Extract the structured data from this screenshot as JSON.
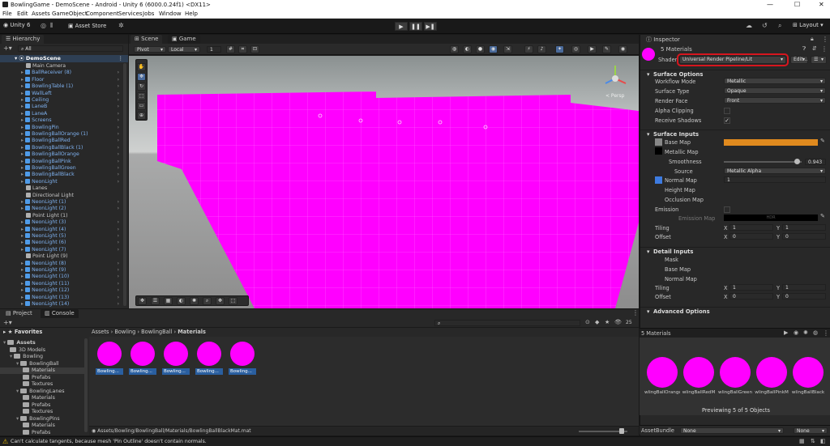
{
  "window": {
    "title": "BowlingGame - DemoScene - Android - Unity 6 (6000.0.24f1) <DX11>",
    "minimize": "—",
    "maximize": "☐",
    "close": "✕"
  },
  "menu": [
    "File",
    "Edit",
    "Assets",
    "GameObject",
    "Component",
    "Services",
    "Jobs",
    "Window",
    "Help"
  ],
  "toolbar": {
    "account": "Unity 6",
    "asset_store": "Asset Store",
    "layout": "Layout",
    "play_icons": [
      "▶",
      "❚❚",
      "▶❚"
    ]
  },
  "hierarchy": {
    "tab": "Hierarchy",
    "search_placeholder": "All",
    "scene": "DemoScene",
    "items": [
      {
        "label": "Main Camera",
        "kind": "g",
        "chev": false
      },
      {
        "label": "BallReceiver (8)",
        "kind": "b",
        "chev": true
      },
      {
        "label": "Floor",
        "kind": "b",
        "chev": true
      },
      {
        "label": "BowlingTable (1)",
        "kind": "b",
        "chev": true
      },
      {
        "label": "WallLeft",
        "kind": "b",
        "chev": true
      },
      {
        "label": "Ceiling",
        "kind": "b",
        "chev": true
      },
      {
        "label": "LaneB",
        "kind": "b",
        "chev": true
      },
      {
        "label": "LaneA",
        "kind": "b",
        "chev": true
      },
      {
        "label": "Screens",
        "kind": "b",
        "chev": true
      },
      {
        "label": "BowlingPin",
        "kind": "b",
        "chev": true
      },
      {
        "label": "BowlingBallOrange (1)",
        "kind": "b",
        "chev": true
      },
      {
        "label": "BowlingBallRed",
        "kind": "b",
        "chev": true
      },
      {
        "label": "BowlingBallBlack (1)",
        "kind": "b",
        "chev": true
      },
      {
        "label": "BowlingBallOrange",
        "kind": "b",
        "chev": true
      },
      {
        "label": "BowlingBallPink",
        "kind": "b",
        "chev": true
      },
      {
        "label": "BowlingBallGreen",
        "kind": "b",
        "chev": true
      },
      {
        "label": "BowlingBallBlack",
        "kind": "b",
        "chev": true
      },
      {
        "label": "NeonLight",
        "kind": "b",
        "chev": true
      },
      {
        "label": "Lanes",
        "kind": "g",
        "chev": false
      },
      {
        "label": "Directional Light",
        "kind": "g",
        "chev": false
      },
      {
        "label": "NeonLight (1)",
        "kind": "b",
        "chev": true
      },
      {
        "label": "NeonLight (2)",
        "kind": "b",
        "chev": true
      },
      {
        "label": "Point Light (1)",
        "kind": "g",
        "chev": false
      },
      {
        "label": "NeonLight (3)",
        "kind": "b",
        "chev": true
      },
      {
        "label": "NeonLight (4)",
        "kind": "b",
        "chev": true
      },
      {
        "label": "NeonLight (5)",
        "kind": "b",
        "chev": true
      },
      {
        "label": "NeonLight (6)",
        "kind": "b",
        "chev": true
      },
      {
        "label": "NeonLight (7)",
        "kind": "b",
        "chev": true
      },
      {
        "label": "Point Light (9)",
        "kind": "g",
        "chev": false
      },
      {
        "label": "NeonLight (8)",
        "kind": "b",
        "chev": true
      },
      {
        "label": "NeonLight (9)",
        "kind": "b",
        "chev": true
      },
      {
        "label": "NeonLight (10)",
        "kind": "b",
        "chev": true
      },
      {
        "label": "NeonLight (11)",
        "kind": "b",
        "chev": true
      },
      {
        "label": "NeonLight (12)",
        "kind": "b",
        "chev": true
      },
      {
        "label": "NeonLight (13)",
        "kind": "b",
        "chev": true
      },
      {
        "label": "NeonLight (14)",
        "kind": "b",
        "chev": true
      }
    ]
  },
  "scene": {
    "tabs": [
      "Scene",
      "Game"
    ],
    "pivot": "Pivot",
    "local": "Local",
    "grid_snap": "1",
    "persp": "< Persp",
    "magenta": "#ff00ff"
  },
  "inspector": {
    "tab": "Inspector",
    "materials_count": "5 Materials",
    "shader_label": "Shader",
    "shader_value": "Universal Render Pipeline/Lit",
    "edit_button": "Edit...",
    "surface_options": {
      "header": "Surface Options",
      "rows": [
        {
          "label": "Workflow Mode",
          "value": "Metallic"
        },
        {
          "label": "Surface Type",
          "value": "Opaque"
        },
        {
          "label": "Render Face",
          "value": "Front"
        }
      ],
      "alpha_clipping": "Alpha Clipping",
      "receive_shadows": "Receive Shadows"
    },
    "surface_inputs": {
      "header": "Surface Inputs",
      "base_map": "Base Map",
      "base_color": "#e08a1e",
      "metallic_map": "Metallic Map",
      "smoothness": "Smoothness",
      "smoothness_value": "0.943",
      "smoothness_fraction": 0.943,
      "source": "Source",
      "source_value": "Metallic Alpha",
      "normal_map": "Normal Map",
      "normal_value": "1",
      "height_map": "Height Map",
      "occlusion_map": "Occlusion Map",
      "emission": "Emission",
      "emission_map": "Emission Map",
      "hdr": "HDR",
      "tiling": "Tiling",
      "offset": "Offset",
      "tiling_x": "1",
      "tiling_y": "1",
      "offset_x": "0",
      "offset_y": "0"
    },
    "detail_inputs": {
      "header": "Detail Inputs",
      "mask": "Mask",
      "base_map": "Base Map",
      "normal_map": "Normal Map",
      "tiling": "Tiling",
      "offset": "Offset",
      "tiling_x": "1",
      "tiling_y": "1",
      "offset_x": "0",
      "offset_y": "0"
    },
    "advanced": "Advanced Options",
    "preview": {
      "title": "5 Materials",
      "labels": [
        "wlingBallOrange",
        "wlingBallRedM",
        "wlingBallGreen",
        "wlingBallPinkM",
        "wlingBallBlack"
      ],
      "status": "Previewing 5 of 5 Objects"
    },
    "asset_bundle": "AssetBundle",
    "bundle_none1": "None",
    "bundle_none2": "None"
  },
  "project": {
    "tabs": [
      "Project",
      "Console"
    ],
    "favorites": "Favorites",
    "breadcrumb": [
      "Assets",
      "Bowling",
      "BowlingBall",
      "Materials"
    ],
    "tree": [
      {
        "label": "Assets",
        "level": 0,
        "bold": true
      },
      {
        "label": "3D Models",
        "level": 1
      },
      {
        "label": "Bowling",
        "level": 1
      },
      {
        "label": "BowlingBall",
        "level": 2
      },
      {
        "label": "Materials",
        "level": 3,
        "selected": true
      },
      {
        "label": "Prefabs",
        "level": 3
      },
      {
        "label": "Textures",
        "level": 3
      },
      {
        "label": "BowlingLanes",
        "level": 2
      },
      {
        "label": "Materials",
        "level": 3
      },
      {
        "label": "Prefabs",
        "level": 3
      },
      {
        "label": "Textures",
        "level": 3
      },
      {
        "label": "BowlingPins",
        "level": 2
      },
      {
        "label": "Materials",
        "level": 3
      },
      {
        "label": "Prefabs",
        "level": 3
      }
    ],
    "assets": [
      "Bowling...",
      "Bowling...",
      "Bowling...",
      "Bowling...",
      "Bowling..."
    ],
    "path": "Assets/Bowling/BowlingBall/Materials/BowlingBallBlackMat.mat",
    "count": "25"
  },
  "status": {
    "message": "Can't calculate tangents, because mesh 'Pin Outline' doesn't contain normals."
  }
}
